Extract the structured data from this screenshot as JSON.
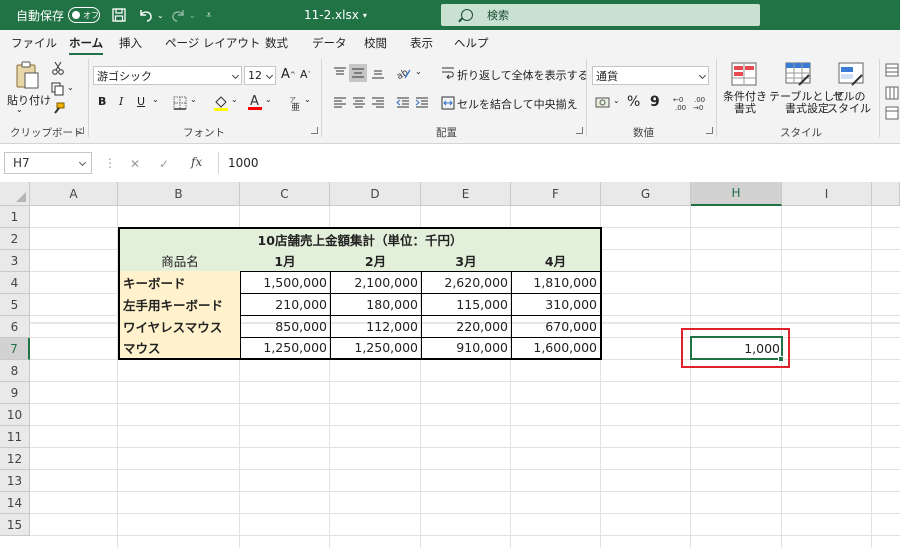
{
  "titlebar": {
    "autosave_label": "自動保存",
    "autosave_state": "オフ",
    "filename": "11-2.xlsx",
    "search_placeholder": "検索"
  },
  "tabs": [
    "ファイル",
    "ホーム",
    "挿入",
    "ページ レイアウト",
    "数式",
    "データ",
    "校閲",
    "表示",
    "ヘルプ"
  ],
  "active_tab": "ホーム",
  "ribbon": {
    "clipboard": {
      "paste": "貼り付け",
      "label": "クリップボード"
    },
    "font": {
      "name": "游ゴシック",
      "size": "12",
      "bold": "B",
      "italic": "I",
      "underline": "U",
      "label": "フォント"
    },
    "alignment": {
      "wrap": "折り返して全体を表示する",
      "merge": "セルを結合して中央揃え",
      "label": "配置"
    },
    "number": {
      "format": "通貨",
      "percent": "%",
      "comma": "9",
      "label": "数値"
    },
    "styles": {
      "conditional": [
        "条件付き",
        "書式"
      ],
      "table": [
        "テーブルとして",
        "書式設定"
      ],
      "cell": [
        "セルの",
        "スタイル"
      ],
      "label": "スタイル"
    }
  },
  "formula_bar": {
    "name_box": "H7",
    "fx": "fx",
    "value": "1000"
  },
  "columns": [
    "A",
    "B",
    "C",
    "D",
    "E",
    "F",
    "G",
    "H",
    "I"
  ],
  "selected_column": "H",
  "rows": [
    "1",
    "2",
    "3",
    "4",
    "5",
    "6",
    "7",
    "8",
    "9",
    "10",
    "11",
    "12",
    "13",
    "14",
    "15"
  ],
  "selected_row": "7",
  "sheet": {
    "table_title": "10店舗売上金額集計（単位：千円）",
    "header": [
      "商品名",
      "1月",
      "2月",
      "3月",
      "4月"
    ],
    "data": [
      {
        "name": "キーボード",
        "values": [
          "1,500,000",
          "2,100,000",
          "2,620,000",
          "1,810,000"
        ]
      },
      {
        "name": "左手用キーボード",
        "values": [
          "210,000",
          "180,000",
          "115,000",
          "310,000"
        ]
      },
      {
        "name": "ワイヤレスマウス",
        "values": [
          "850,000",
          "112,000",
          "220,000",
          "670,000"
        ]
      },
      {
        "name": "マウス",
        "values": [
          "1,250,000",
          "1,250,000",
          "910,000",
          "1,600,000"
        ]
      }
    ],
    "active_cell_value": "1,000"
  },
  "colors": {
    "accent": "#217346",
    "highlight": "#e0202a",
    "header_fill": "#e2efda",
    "name_fill": "#fff2cc"
  }
}
